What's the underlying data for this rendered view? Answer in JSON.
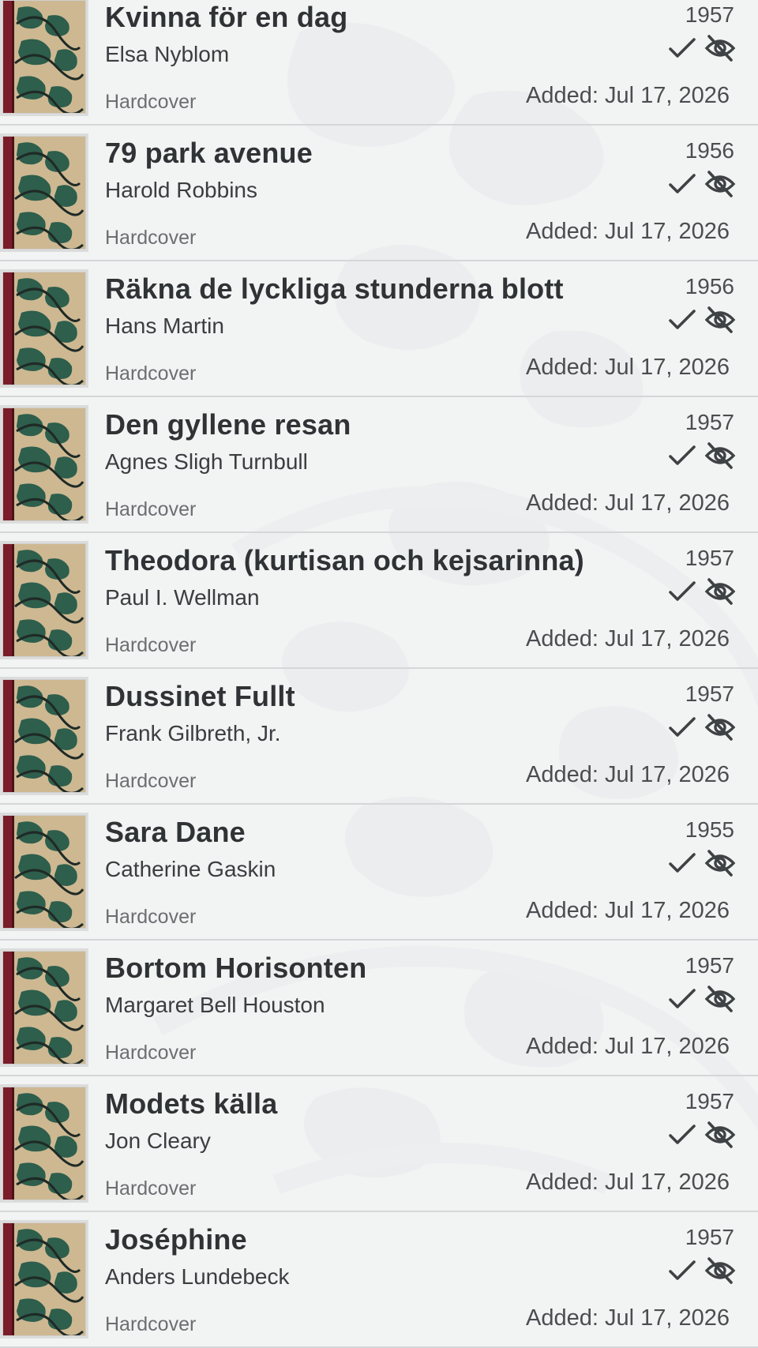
{
  "books": [
    {
      "title": "Kvinna för en dag",
      "author": "Elsa Nyblom",
      "format": "Hardcover",
      "year": "1957",
      "added": "Added: Jul 17, 2026"
    },
    {
      "title": "79 park avenue",
      "author": "Harold Robbins",
      "format": "Hardcover",
      "year": "1956",
      "added": "Added: Jul 17, 2026"
    },
    {
      "title": "Räkna de lyckliga stunderna blott",
      "author": "Hans Martin",
      "format": "Hardcover",
      "year": "1956",
      "added": "Added: Jul 17, 2026"
    },
    {
      "title": "Den gyllene resan",
      "author": "Agnes Sligh Turnbull",
      "format": "Hardcover",
      "year": "1957",
      "added": "Added: Jul 17, 2026"
    },
    {
      "title": "Theodora (kurtisan och kejsarinna)",
      "author": "Paul I. Wellman",
      "format": "Hardcover",
      "year": "1957",
      "added": "Added: Jul 17, 2026"
    },
    {
      "title": "Dussinet Fullt",
      "author": "Frank Gilbreth, Jr.",
      "format": "Hardcover",
      "year": "1957",
      "added": "Added: Jul 17, 2026"
    },
    {
      "title": "Sara Dane",
      "author": "Catherine Gaskin",
      "format": "Hardcover",
      "year": "1955",
      "added": "Added: Jul 17, 2026"
    },
    {
      "title": "Bortom Horisonten",
      "author": "Margaret Bell Houston",
      "format": "Hardcover",
      "year": "1957",
      "added": "Added: Jul 17, 2026"
    },
    {
      "title": "Modets källa",
      "author": "Jon Cleary",
      "format": "Hardcover",
      "year": "1957",
      "added": "Added: Jul 17, 2026"
    },
    {
      "title": "Joséphine",
      "author": "Anders Lundebeck",
      "format": "Hardcover",
      "year": "1957",
      "added": "Added: Jul 17, 2026"
    }
  ],
  "icons": {
    "read": "checkmark-icon",
    "hidden": "eye-slash-icon"
  },
  "colors": {
    "text_primary": "#2f3335",
    "text_secondary": "#4a4e50",
    "divider": "#d4d7d8",
    "icon": "#3e4244",
    "cover_spine": "#7a1d28",
    "cover_green": "#2e5e4c"
  }
}
